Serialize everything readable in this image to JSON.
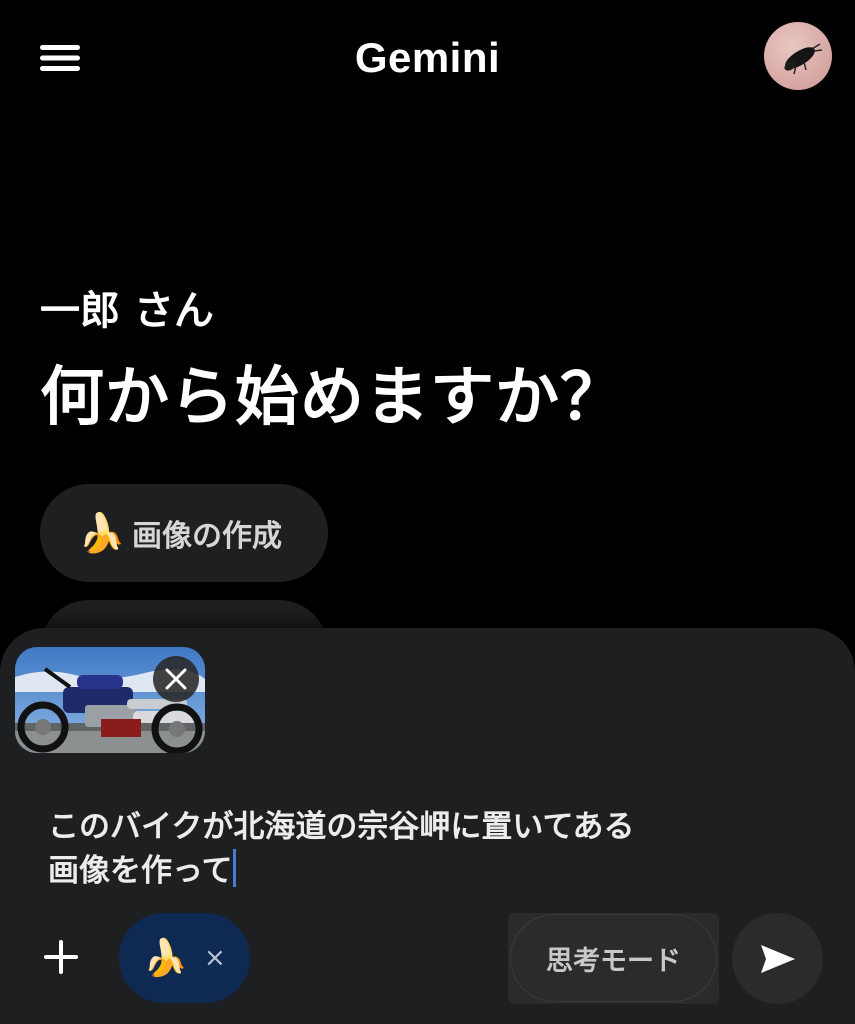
{
  "header": {
    "title": "Gemini",
    "menu_icon": "hamburger-menu-icon",
    "avatar_icon": "profile-avatar"
  },
  "greeting": {
    "name": "一郎 さん",
    "question": "何から始めますか？"
  },
  "suggestions": [
    {
      "icon": "🍌",
      "label": "画像の作成"
    }
  ],
  "composer": {
    "prompt_line1": "このバイクが北海道の宗谷岬に置いてある",
    "prompt_line2": "画像を作って",
    "attachment_icon": "motorcycle-photo",
    "remove_attachment_icon": "close-icon",
    "add_icon": "plus-icon",
    "tool_chip": {
      "icon": "🍌",
      "remove": "×"
    },
    "mode_label": "思考モード",
    "send_icon": "send-icon"
  },
  "colors": {
    "background": "#000000",
    "surface": "#1e1f20",
    "tool_chip_bg": "#0f2a52",
    "caret": "#4a7bd6"
  }
}
